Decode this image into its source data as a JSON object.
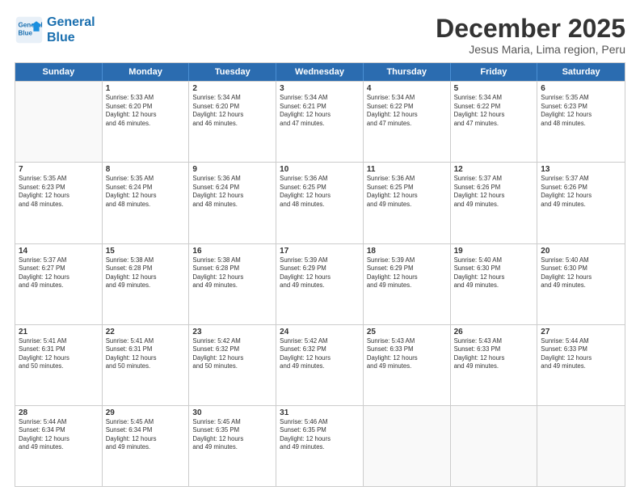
{
  "logo": {
    "line1": "General",
    "line2": "Blue"
  },
  "title": "December 2025",
  "subtitle": "Jesus Maria, Lima region, Peru",
  "header_days": [
    "Sunday",
    "Monday",
    "Tuesday",
    "Wednesday",
    "Thursday",
    "Friday",
    "Saturday"
  ],
  "weeks": [
    [
      {
        "day": "",
        "info": ""
      },
      {
        "day": "1",
        "info": "Sunrise: 5:33 AM\nSunset: 6:20 PM\nDaylight: 12 hours\nand 46 minutes."
      },
      {
        "day": "2",
        "info": "Sunrise: 5:34 AM\nSunset: 6:20 PM\nDaylight: 12 hours\nand 46 minutes."
      },
      {
        "day": "3",
        "info": "Sunrise: 5:34 AM\nSunset: 6:21 PM\nDaylight: 12 hours\nand 47 minutes."
      },
      {
        "day": "4",
        "info": "Sunrise: 5:34 AM\nSunset: 6:22 PM\nDaylight: 12 hours\nand 47 minutes."
      },
      {
        "day": "5",
        "info": "Sunrise: 5:34 AM\nSunset: 6:22 PM\nDaylight: 12 hours\nand 47 minutes."
      },
      {
        "day": "6",
        "info": "Sunrise: 5:35 AM\nSunset: 6:23 PM\nDaylight: 12 hours\nand 48 minutes."
      }
    ],
    [
      {
        "day": "7",
        "info": "Sunrise: 5:35 AM\nSunset: 6:23 PM\nDaylight: 12 hours\nand 48 minutes."
      },
      {
        "day": "8",
        "info": "Sunrise: 5:35 AM\nSunset: 6:24 PM\nDaylight: 12 hours\nand 48 minutes."
      },
      {
        "day": "9",
        "info": "Sunrise: 5:36 AM\nSunset: 6:24 PM\nDaylight: 12 hours\nand 48 minutes."
      },
      {
        "day": "10",
        "info": "Sunrise: 5:36 AM\nSunset: 6:25 PM\nDaylight: 12 hours\nand 48 minutes."
      },
      {
        "day": "11",
        "info": "Sunrise: 5:36 AM\nSunset: 6:25 PM\nDaylight: 12 hours\nand 49 minutes."
      },
      {
        "day": "12",
        "info": "Sunrise: 5:37 AM\nSunset: 6:26 PM\nDaylight: 12 hours\nand 49 minutes."
      },
      {
        "day": "13",
        "info": "Sunrise: 5:37 AM\nSunset: 6:26 PM\nDaylight: 12 hours\nand 49 minutes."
      }
    ],
    [
      {
        "day": "14",
        "info": "Sunrise: 5:37 AM\nSunset: 6:27 PM\nDaylight: 12 hours\nand 49 minutes."
      },
      {
        "day": "15",
        "info": "Sunrise: 5:38 AM\nSunset: 6:28 PM\nDaylight: 12 hours\nand 49 minutes."
      },
      {
        "day": "16",
        "info": "Sunrise: 5:38 AM\nSunset: 6:28 PM\nDaylight: 12 hours\nand 49 minutes."
      },
      {
        "day": "17",
        "info": "Sunrise: 5:39 AM\nSunset: 6:29 PM\nDaylight: 12 hours\nand 49 minutes."
      },
      {
        "day": "18",
        "info": "Sunrise: 5:39 AM\nSunset: 6:29 PM\nDaylight: 12 hours\nand 49 minutes."
      },
      {
        "day": "19",
        "info": "Sunrise: 5:40 AM\nSunset: 6:30 PM\nDaylight: 12 hours\nand 49 minutes."
      },
      {
        "day": "20",
        "info": "Sunrise: 5:40 AM\nSunset: 6:30 PM\nDaylight: 12 hours\nand 49 minutes."
      }
    ],
    [
      {
        "day": "21",
        "info": "Sunrise: 5:41 AM\nSunset: 6:31 PM\nDaylight: 12 hours\nand 50 minutes."
      },
      {
        "day": "22",
        "info": "Sunrise: 5:41 AM\nSunset: 6:31 PM\nDaylight: 12 hours\nand 50 minutes."
      },
      {
        "day": "23",
        "info": "Sunrise: 5:42 AM\nSunset: 6:32 PM\nDaylight: 12 hours\nand 50 minutes."
      },
      {
        "day": "24",
        "info": "Sunrise: 5:42 AM\nSunset: 6:32 PM\nDaylight: 12 hours\nand 49 minutes."
      },
      {
        "day": "25",
        "info": "Sunrise: 5:43 AM\nSunset: 6:33 PM\nDaylight: 12 hours\nand 49 minutes."
      },
      {
        "day": "26",
        "info": "Sunrise: 5:43 AM\nSunset: 6:33 PM\nDaylight: 12 hours\nand 49 minutes."
      },
      {
        "day": "27",
        "info": "Sunrise: 5:44 AM\nSunset: 6:33 PM\nDaylight: 12 hours\nand 49 minutes."
      }
    ],
    [
      {
        "day": "28",
        "info": "Sunrise: 5:44 AM\nSunset: 6:34 PM\nDaylight: 12 hours\nand 49 minutes."
      },
      {
        "day": "29",
        "info": "Sunrise: 5:45 AM\nSunset: 6:34 PM\nDaylight: 12 hours\nand 49 minutes."
      },
      {
        "day": "30",
        "info": "Sunrise: 5:45 AM\nSunset: 6:35 PM\nDaylight: 12 hours\nand 49 minutes."
      },
      {
        "day": "31",
        "info": "Sunrise: 5:46 AM\nSunset: 6:35 PM\nDaylight: 12 hours\nand 49 minutes."
      },
      {
        "day": "",
        "info": ""
      },
      {
        "day": "",
        "info": ""
      },
      {
        "day": "",
        "info": ""
      }
    ]
  ]
}
